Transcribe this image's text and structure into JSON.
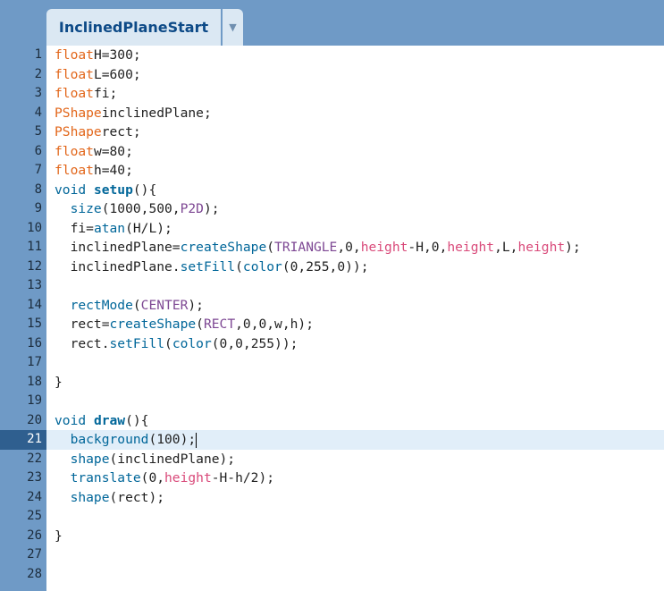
{
  "tab": {
    "title": "InclinedPlaneStart",
    "menu_icon": "dropdown-triangle-icon"
  },
  "current_line": 21,
  "line_numbers": [
    "1",
    "2",
    "3",
    "4",
    "5",
    "6",
    "7",
    "8",
    "9",
    "10",
    "11",
    "12",
    "13",
    "14",
    "15",
    "16",
    "17",
    "18",
    "19",
    "20",
    "21",
    "22",
    "23",
    "24",
    "25",
    "26",
    "27",
    "28"
  ],
  "code": [
    [
      [
        "kw",
        "float"
      ],
      [
        "",
        "H=300;"
      ]
    ],
    [
      [
        "kw",
        "float"
      ],
      [
        "",
        "L=600;"
      ]
    ],
    [
      [
        "kw",
        "float"
      ],
      [
        "",
        "fi;"
      ]
    ],
    [
      [
        "kw",
        "PShape"
      ],
      [
        "",
        "inclinedPlane;"
      ]
    ],
    [
      [
        "kw",
        "PShape"
      ],
      [
        "",
        "rect;"
      ]
    ],
    [
      [
        "kw",
        "float"
      ],
      [
        "",
        "w=80;"
      ]
    ],
    [
      [
        "kw",
        "float"
      ],
      [
        "",
        "h=40;"
      ]
    ],
    [
      [
        "fn",
        "void"
      ],
      [
        "",
        " "
      ],
      [
        "fnb",
        "setup"
      ],
      [
        "",
        "(){"
      ]
    ],
    [
      [
        "",
        "  "
      ],
      [
        "fn",
        "size"
      ],
      [
        "",
        "(1000,500,"
      ],
      [
        "const",
        "P2D"
      ],
      [
        "",
        ");"
      ]
    ],
    [
      [
        "",
        "  fi="
      ],
      [
        "fn",
        "atan"
      ],
      [
        "",
        "(H/L);"
      ]
    ],
    [
      [
        "",
        "  inclinedPlane="
      ],
      [
        "fn",
        "createShape"
      ],
      [
        "",
        "("
      ],
      [
        "const",
        "TRIANGLE"
      ],
      [
        "",
        ",0,"
      ],
      [
        "pink",
        "height"
      ],
      [
        "",
        "-H,0,"
      ],
      [
        "pink",
        "height"
      ],
      [
        "",
        ",L,"
      ],
      [
        "pink",
        "height"
      ],
      [
        "",
        ");"
      ]
    ],
    [
      [
        "",
        "  inclinedPlane."
      ],
      [
        "fn",
        "setFill"
      ],
      [
        "",
        "("
      ],
      [
        "fn",
        "color"
      ],
      [
        "",
        "(0,255,0));"
      ]
    ],
    [],
    [
      [
        "",
        "  "
      ],
      [
        "fn",
        "rectMode"
      ],
      [
        "",
        "("
      ],
      [
        "const",
        "CENTER"
      ],
      [
        "",
        ");"
      ]
    ],
    [
      [
        "",
        "  rect="
      ],
      [
        "fn",
        "createShape"
      ],
      [
        "",
        "("
      ],
      [
        "const",
        "RECT"
      ],
      [
        "",
        ",0,0,w,h);"
      ]
    ],
    [
      [
        "",
        "  rect."
      ],
      [
        "fn",
        "setFill"
      ],
      [
        "",
        "("
      ],
      [
        "fn",
        "color"
      ],
      [
        "",
        "(0,0,255));"
      ]
    ],
    [],
    [
      [
        "",
        "}"
      ]
    ],
    [],
    [
      [
        "fn",
        "void"
      ],
      [
        "",
        " "
      ],
      [
        "fnb",
        "draw"
      ],
      [
        "",
        "(){"
      ]
    ],
    [
      [
        "",
        "  "
      ],
      [
        "fn",
        "background"
      ],
      [
        "",
        "(100);"
      ]
    ],
    [
      [
        "",
        "  "
      ],
      [
        "fn",
        "shape"
      ],
      [
        "",
        "(inclinedPlane);"
      ]
    ],
    [
      [
        "",
        "  "
      ],
      [
        "fn",
        "translate"
      ],
      [
        "",
        "(0,"
      ],
      [
        "pink",
        "height"
      ],
      [
        "",
        "-H-h/2);"
      ]
    ],
    [
      [
        "",
        "  "
      ],
      [
        "fn",
        "shape"
      ],
      [
        "",
        "(rect);"
      ]
    ],
    [],
    [
      [
        "",
        "}"
      ]
    ],
    [],
    []
  ]
}
